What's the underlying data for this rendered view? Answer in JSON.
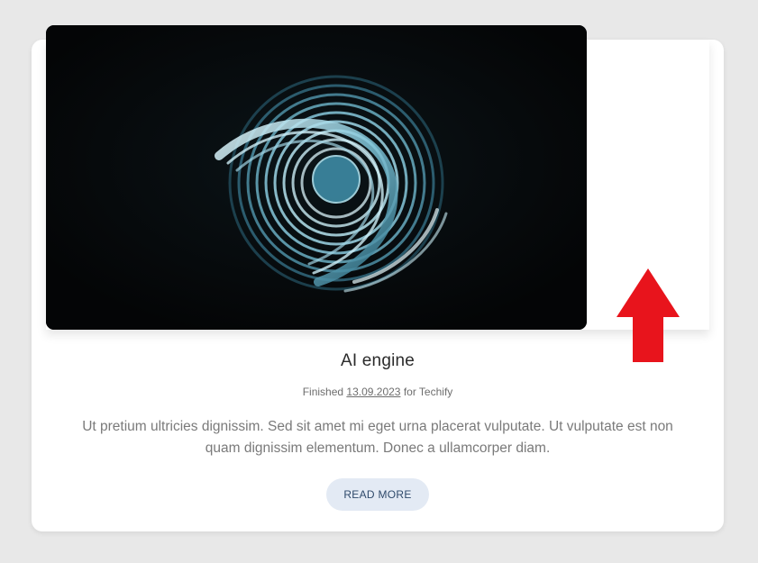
{
  "card": {
    "title": "AI engine",
    "meta": {
      "prefix": "Finished",
      "date": "13.09.2023",
      "suffix": "for Techify"
    },
    "description": "Ut pretium ultricies dignissim. Sed sit amet mi eget urna placerat vulputate. Ut vulputate est non quam dignissim elementum. Donec a ullamcorper diam.",
    "button_label": "READ MORE"
  },
  "image": {
    "subject": "abstract-spiral-render"
  },
  "overlay": {
    "arrow_direction": "up",
    "arrow_color": "#e8141c"
  },
  "colors": {
    "page_background": "#e8e8e8",
    "card_background": "#ffffff",
    "button_background": "#e3eaf4",
    "button_text": "#2f4a6b"
  }
}
